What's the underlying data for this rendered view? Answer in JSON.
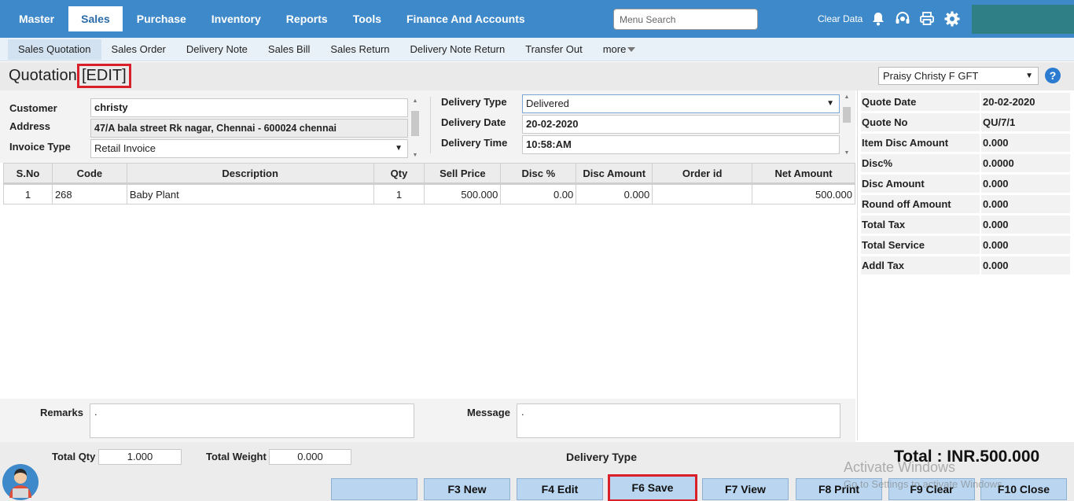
{
  "topnav": {
    "items": [
      {
        "label": "Master"
      },
      {
        "label": "Sales"
      },
      {
        "label": "Purchase"
      },
      {
        "label": "Inventory"
      },
      {
        "label": "Reports"
      },
      {
        "label": "Tools"
      },
      {
        "label": "Finance And Accounts"
      }
    ],
    "active_index": 1,
    "search_placeholder": "Menu Search",
    "clear_data": "Clear Data",
    "icons": [
      "bell-icon",
      "headset-icon",
      "printer-icon",
      "gear-icon"
    ]
  },
  "subnav": {
    "items": [
      {
        "label": "Sales Quotation"
      },
      {
        "label": "Sales Order"
      },
      {
        "label": "Delivery Note"
      },
      {
        "label": "Sales Bill"
      },
      {
        "label": "Sales Return"
      },
      {
        "label": "Delivery Note Return"
      },
      {
        "label": "Transfer Out"
      },
      {
        "label": "more"
      }
    ],
    "active_index": 0
  },
  "header": {
    "title": "Quotation",
    "mode": "[EDIT]",
    "user": "Praisy Christy F GFT",
    "help": "?"
  },
  "form": {
    "customer_label": "Customer",
    "customer_value": "christy",
    "address_label": "Address",
    "address_value": "47/A bala street Rk nagar, Chennai - 600024 chennai",
    "invoice_type_label": "Invoice Type",
    "invoice_type_value": "Retail Invoice",
    "delivery_type_label": "Delivery Type",
    "delivery_type_value": "Delivered",
    "delivery_date_label": "Delivery Date",
    "delivery_date_value": "20-02-2020",
    "delivery_time_label": "Delivery Time",
    "delivery_time_value": "10:58:AM"
  },
  "table": {
    "columns": [
      "S.No",
      "Code",
      "Description",
      "Qty",
      "Sell Price",
      "Disc %",
      "Disc Amount",
      "Order id",
      "Net Amount"
    ],
    "rows": [
      [
        "1",
        "268",
        "Baby Plant",
        "1",
        "500.000",
        "0.00",
        "0.000",
        "",
        "500.000"
      ]
    ]
  },
  "summary": [
    {
      "label": "Quote Date",
      "value": "20-02-2020"
    },
    {
      "label": "Quote No",
      "value": "QU/7/1"
    },
    {
      "label": "Item Disc Amount",
      "value": "0.000"
    },
    {
      "label": "Disc%",
      "value": "0.0000"
    },
    {
      "label": "Disc Amount",
      "value": "0.000"
    },
    {
      "label": "Round off Amount",
      "value": "0.000"
    },
    {
      "label": "Total Tax",
      "value": "0.000"
    },
    {
      "label": "Total Service",
      "value": "0.000"
    },
    {
      "label": "Addl Tax",
      "value": "0.000"
    }
  ],
  "notes": {
    "remarks_label": "Remarks",
    "remarks_value": ".",
    "message_label": "Message",
    "message_value": "."
  },
  "totals": {
    "total_qty_label": "Total Qty",
    "total_qty_value": "1.000",
    "total_weight_label": "Total Weight",
    "total_weight_value": "0.000",
    "delivery_type_label": "Delivery Type",
    "grand_total": "Total : INR.500.000"
  },
  "buttons": {
    "blank": "",
    "new": "F3 New",
    "edit": "F4 Edit",
    "save": "F6 Save",
    "view": "F7 View",
    "print": "F8 Print",
    "clear": "F9 Clear",
    "close": "F10 Close"
  },
  "watermark": {
    "line1": "Activate Windows",
    "line2": "Go to Settings to activate Windows."
  },
  "colors": {
    "nav": "#3e89c9",
    "highlight": "#d9202a",
    "button": "#b9d5ef"
  }
}
